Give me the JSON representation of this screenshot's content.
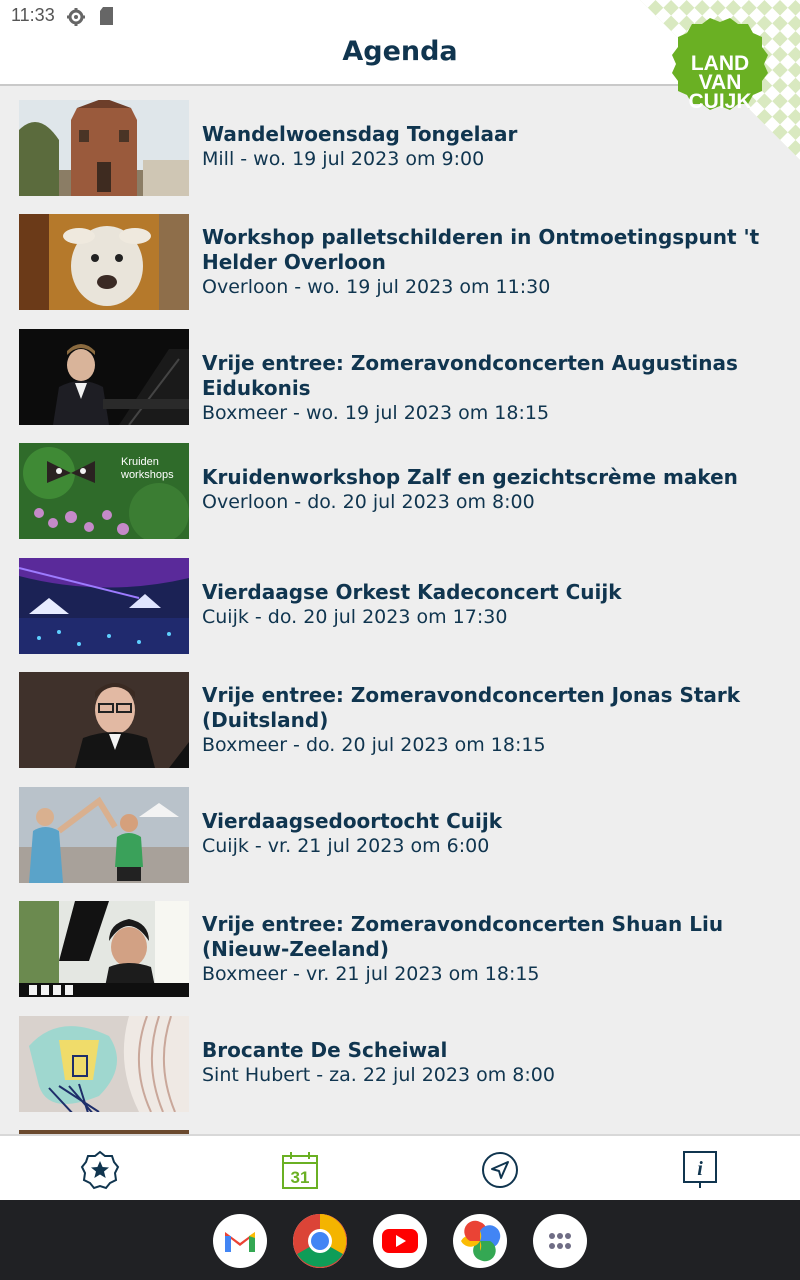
{
  "status": {
    "time": "11:33"
  },
  "header": {
    "title": "Agenda"
  },
  "logo": {
    "line1": "LAND",
    "line2": "VAN",
    "line3": "CUIJK",
    "color": "#6ab023"
  },
  "events": [
    {
      "title": "Wandelwoensdag Tongelaar",
      "subtitle": "Mill - wo. 19 jul 2023 om 9:00"
    },
    {
      "title": "Workshop palletschilderen in Ontmoetingspunt 't Helder Overloon",
      "subtitle": "Overloon - wo. 19 jul 2023 om 11:30"
    },
    {
      "title": "Vrije entree: Zomeravondconcerten Augustinas Eidukonis",
      "subtitle": "Boxmeer - wo. 19 jul 2023 om 18:15"
    },
    {
      "title": "Kruidenworkshop Zalf en gezichtscrème maken",
      "subtitle": "Overloon - do. 20 jul 2023 om 8:00",
      "thumb_text_1": "Kruiden",
      "thumb_text_2": "workshops"
    },
    {
      "title": "Vierdaagse Orkest Kadeconcert Cuijk",
      "subtitle": "Cuijk - do. 20 jul 2023 om 17:30"
    },
    {
      "title": "Vrije entree: Zomeravondconcerten Jonas Stark (Duitsland)",
      "subtitle": "Boxmeer - do. 20 jul 2023 om 18:15"
    },
    {
      "title": "Vierdaagsedoortocht Cuijk",
      "subtitle": "Cuijk - vr. 21 jul 2023 om 6:00"
    },
    {
      "title": "Vrije entree: Zomeravondconcerten Shuan Liu (Nieuw-Zeeland)",
      "subtitle": "Boxmeer - vr. 21 jul 2023 om 18:15"
    },
    {
      "title": "Brocante De Scheiwal",
      "subtitle": "Sint Hubert - za. 22 jul 2023 om 8:00"
    }
  ],
  "tabs": [
    {
      "icon": "star-badge-icon"
    },
    {
      "icon": "calendar-icon",
      "label": "31",
      "active": true,
      "color": "#6ab023"
    },
    {
      "icon": "navigation-icon"
    },
    {
      "icon": "info-icon",
      "label": "i"
    }
  ],
  "dock": [
    {
      "icon": "gmail-icon"
    },
    {
      "icon": "chrome-icon"
    },
    {
      "icon": "youtube-icon"
    },
    {
      "icon": "photos-icon"
    },
    {
      "icon": "app-drawer-icon"
    }
  ]
}
